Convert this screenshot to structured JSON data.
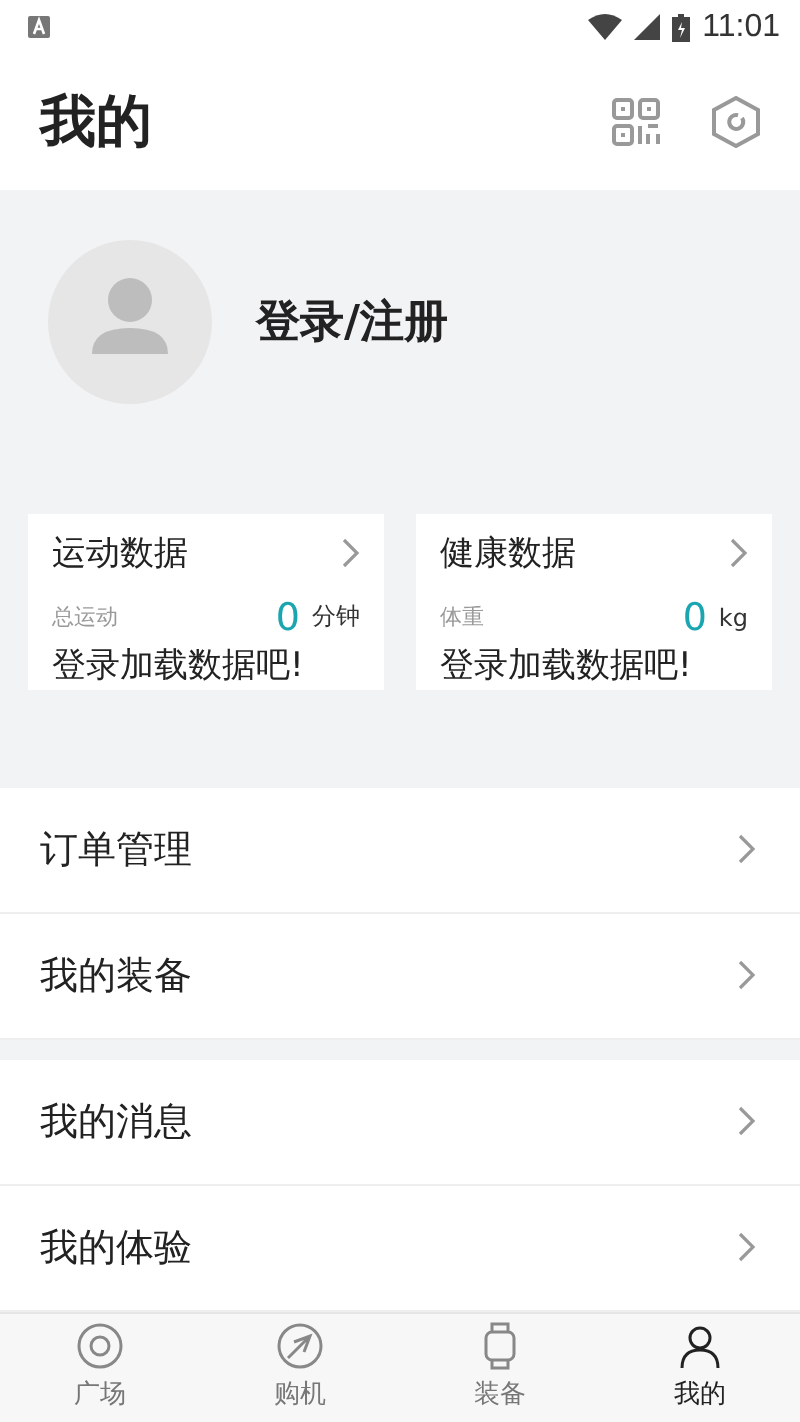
{
  "status_bar": {
    "time": "11:01"
  },
  "header": {
    "title": "我的"
  },
  "profile": {
    "login": "登录/注册"
  },
  "cards": [
    {
      "title": "运动数据",
      "label": "总运动",
      "value": "0",
      "unit": "分钟",
      "prompt": "登录加载数据吧!"
    },
    {
      "title": "健康数据",
      "label": "体重",
      "value": "0",
      "unit": "kg",
      "prompt": "登录加载数据吧!"
    }
  ],
  "menu_groups": [
    [
      {
        "label": "订单管理"
      },
      {
        "label": "我的装备"
      }
    ],
    [
      {
        "label": "我的消息"
      },
      {
        "label": "我的体验"
      }
    ]
  ],
  "tab_bar": [
    {
      "label": "广场",
      "kind": "plaza",
      "selected": false
    },
    {
      "label": "购机",
      "kind": "buy",
      "selected": false
    },
    {
      "label": "装备",
      "kind": "gear",
      "selected": false
    },
    {
      "label": "我的",
      "kind": "me",
      "selected": true
    }
  ]
}
